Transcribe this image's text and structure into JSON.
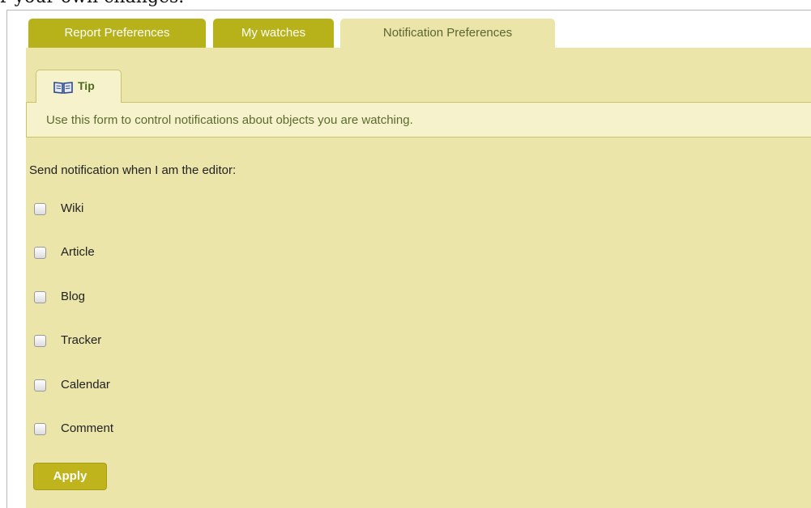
{
  "header": {
    "intro_fragment": "r your own changes."
  },
  "tabs": [
    {
      "label": "Report Preferences",
      "active": false
    },
    {
      "label": "My watches",
      "active": false
    },
    {
      "label": "Notification Preferences",
      "active": true
    }
  ],
  "tip": {
    "icon": "book-icon",
    "label": "Tip",
    "text": "Use this form to control notifications about objects you are watching."
  },
  "form": {
    "heading": "Send notification when I am the editor:",
    "options": [
      {
        "label": "Wiki",
        "checked": false
      },
      {
        "label": "Article",
        "checked": false
      },
      {
        "label": "Blog",
        "checked": false
      },
      {
        "label": "Tracker",
        "checked": false
      },
      {
        "label": "Calendar",
        "checked": false
      },
      {
        "label": "Comment",
        "checked": false
      }
    ],
    "apply_label": "Apply"
  },
  "colors": {
    "tab_inactive": "#b8b21a",
    "panel_background": "#ebe5aa",
    "tip_background": "#f6f3cc",
    "apply_button": "#c0b41c"
  }
}
